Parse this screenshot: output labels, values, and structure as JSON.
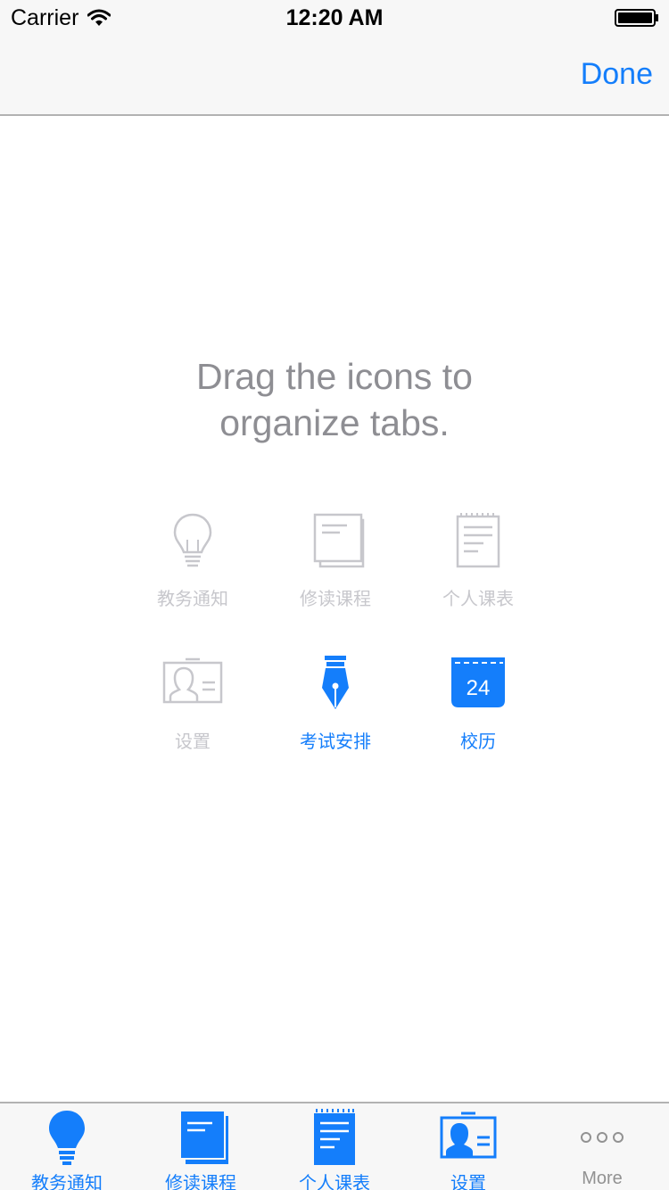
{
  "status_bar": {
    "carrier": "Carrier",
    "time": "12:20 AM"
  },
  "nav": {
    "done_label": "Done"
  },
  "instructions": {
    "line1": "Drag the icons to",
    "line2": "organize tabs."
  },
  "grid": {
    "items": [
      {
        "label": "教务通知",
        "icon": "lightbulb-icon"
      },
      {
        "label": "修读课程",
        "icon": "documents-icon"
      },
      {
        "label": "个人课表",
        "icon": "notepad-icon"
      },
      {
        "label": "设置",
        "icon": "id-card-icon"
      },
      {
        "label": "考试安排",
        "icon": "fountain-pen-icon"
      },
      {
        "label": "校历",
        "icon": "calendar-icon",
        "day": "24"
      }
    ]
  },
  "tabbar": {
    "tabs": [
      {
        "label": "教务通知",
        "icon": "lightbulb-icon"
      },
      {
        "label": "修读课程",
        "icon": "documents-icon"
      },
      {
        "label": "个人课表",
        "icon": "notepad-icon"
      },
      {
        "label": "设置",
        "icon": "id-card-icon"
      },
      {
        "label": "More",
        "icon": "more-dots-icon"
      }
    ]
  },
  "colors": {
    "accent": "#147efb",
    "disabled": "#c7c7cc",
    "secondary_text": "#8e8e93",
    "bar_background": "#f7f7f7"
  }
}
